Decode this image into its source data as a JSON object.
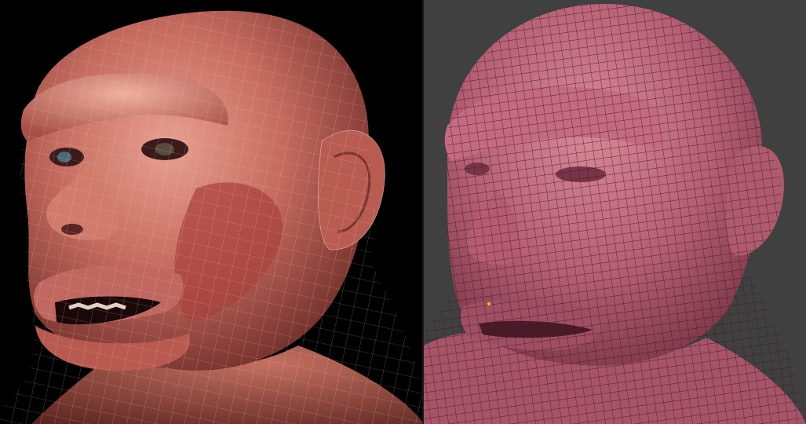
{
  "image": {
    "panels": [
      {
        "id": "textured-render",
        "background": "#000000",
        "skin_color": "#c46a5e",
        "wire_color": "#f0c8c8"
      },
      {
        "id": "wireframe-viewport",
        "background": "#404040",
        "skin_color": "#b55e74",
        "wire_color": "#3a1822"
      }
    ]
  }
}
